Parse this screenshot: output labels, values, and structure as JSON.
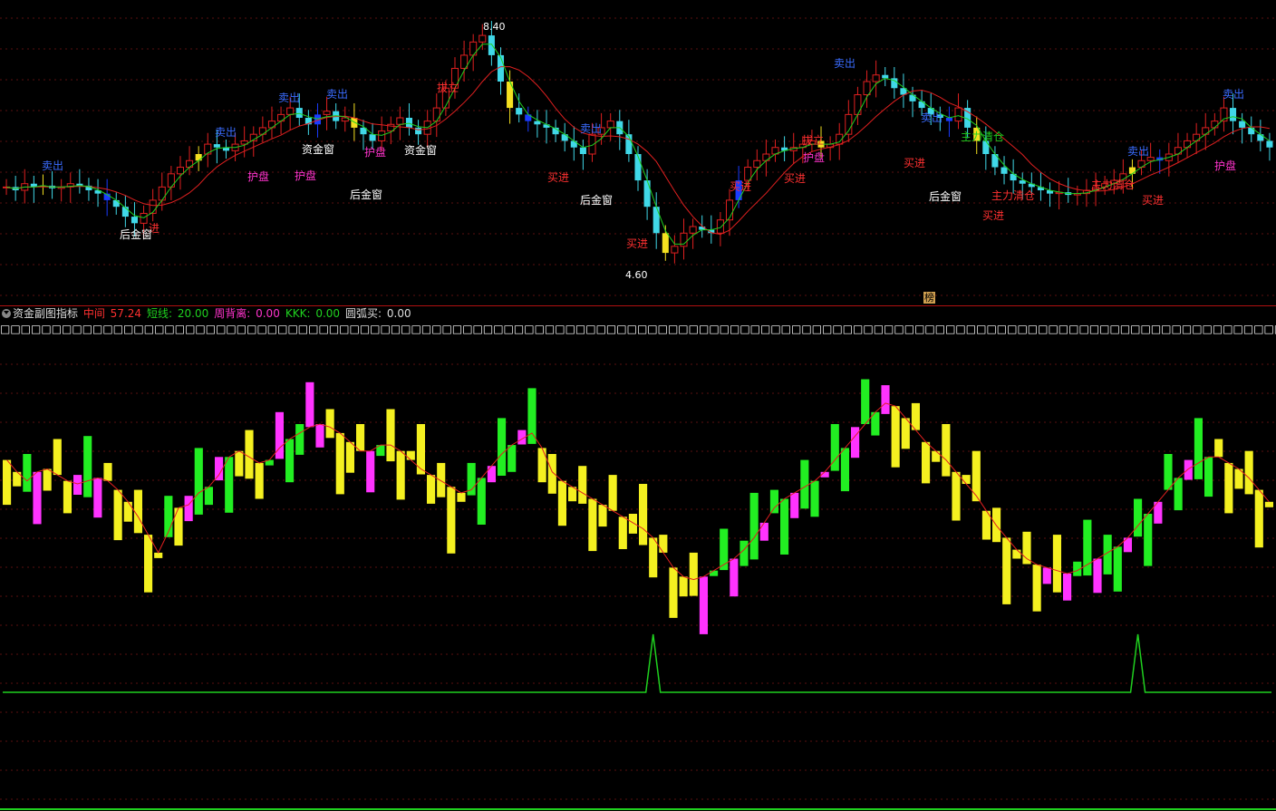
{
  "main_chart": {
    "high_label": "8.40",
    "low_label": "4.60",
    "annotations": [
      {
        "text": "卖出",
        "color": "#3a6cff",
        "x": 58,
        "y": 187
      },
      {
        "text": "进",
        "color": "#ff3030",
        "x": 170,
        "y": 256
      },
      {
        "text": "后金窗",
        "color": "#ffffff",
        "x": 150,
        "y": 263
      },
      {
        "text": "卖出",
        "color": "#3a6cff",
        "x": 249,
        "y": 150
      },
      {
        "text": "卖出",
        "color": "#3a6cff",
        "x": 319,
        "y": 112
      },
      {
        "text": "卖出",
        "color": "#3a6cff",
        "x": 372,
        "y": 108
      },
      {
        "text": "护盘",
        "color": "#ff33cc",
        "x": 285,
        "y": 199
      },
      {
        "text": "护盘",
        "color": "#ff33cc",
        "x": 337,
        "y": 198
      },
      {
        "text": "资金窗",
        "color": "#ffffff",
        "x": 351,
        "y": 169
      },
      {
        "text": "护盘",
        "color": "#ff33cc",
        "x": 414,
        "y": 172
      },
      {
        "text": "后金窗",
        "color": "#ffffff",
        "x": 404,
        "y": 219
      },
      {
        "text": "资金窗",
        "color": "#ffffff",
        "x": 464,
        "y": 170
      },
      {
        "text": "拔立",
        "color": "#ff3030",
        "x": 494,
        "y": 101
      },
      {
        "text": "卖出",
        "color": "#3a6cff",
        "x": 652,
        "y": 146
      },
      {
        "text": "买进",
        "color": "#ff3030",
        "x": 616,
        "y": 200
      },
      {
        "text": "后金窗",
        "color": "#ffffff",
        "x": 658,
        "y": 225
      },
      {
        "text": "买进",
        "color": "#ff3030",
        "x": 703,
        "y": 273
      },
      {
        "text": "买进",
        "color": "#ff3030",
        "x": 817,
        "y": 210
      },
      {
        "text": "买进",
        "color": "#ff3030",
        "x": 877,
        "y": 201
      },
      {
        "text": "拔立",
        "color": "#ff3030",
        "x": 897,
        "y": 159
      },
      {
        "text": "护盘",
        "color": "#ff33cc",
        "x": 898,
        "y": 178
      },
      {
        "text": "卖出",
        "color": "#3a6cff",
        "x": 932,
        "y": 74
      },
      {
        "text": "卖出",
        "color": "#3a6cff",
        "x": 1028,
        "y": 134
      },
      {
        "text": "买进",
        "color": "#ff3030",
        "x": 1009,
        "y": 184
      },
      {
        "text": "主力清仓",
        "color": "#1fd01f",
        "x": 1084,
        "y": 155
      },
      {
        "text": "后金窗",
        "color": "#ffffff",
        "x": 1043,
        "y": 221
      },
      {
        "text": "主力清仓",
        "color": "#ff3030",
        "x": 1118,
        "y": 220
      },
      {
        "text": "买进",
        "color": "#ff3030",
        "x": 1096,
        "y": 242
      },
      {
        "text": "卖出",
        "color": "#3a6cff",
        "x": 1256,
        "y": 171
      },
      {
        "text": "主力清仓",
        "color": "#ff3030",
        "x": 1228,
        "y": 208
      },
      {
        "text": "买进",
        "color": "#ff3030",
        "x": 1272,
        "y": 225
      },
      {
        "text": "卖出",
        "color": "#3a6cff",
        "x": 1361,
        "y": 108
      },
      {
        "text": "护盘",
        "color": "#ff33cc",
        "x": 1352,
        "y": 187
      }
    ],
    "corner_badge": "榜"
  },
  "info_bar": {
    "indicator_name": "资金副图指标",
    "items": [
      {
        "label": "中间",
        "value": "57.24",
        "label_color": "#ff3030",
        "value_color": "#ff3030"
      },
      {
        "label": "短线:",
        "value": "20.00",
        "label_color": "#1fd01f",
        "value_color": "#1fd01f"
      },
      {
        "label": "周背离:",
        "value": "0.00",
        "label_color": "#ff33cc",
        "value_color": "#ff33cc"
      },
      {
        "label": "KKK:",
        "value": "0.00",
        "label_color": "#1fd01f",
        "value_color": "#1fd01f"
      },
      {
        "label": "圆弧买:",
        "value": "0.00",
        "label_color": "#dddddd",
        "value_color": "#dddddd"
      }
    ]
  },
  "indicator_strip": "□□□□□□□□□□□□□□□□□□□□□□□□□□□□□□□□□□□□□□□□□□□□□□□□□□□□□□□□□□□□□□□□□□□□□□□□□□□□□□□□□□□□□□□□□□□□□□□□□□□□□□□□□□□□□□□□□□□□□□□□□□□□□□□□□□",
  "chart_data": [
    {
      "type": "candlestick",
      "title": "",
      "ylim": [
        4.2,
        8.6
      ],
      "high_marker": 8.4,
      "low_marker": 4.6,
      "close_series": [
        5.9,
        5.85,
        5.95,
        5.9,
        5.92,
        5.88,
        5.9,
        5.95,
        5.92,
        5.85,
        5.8,
        5.7,
        5.6,
        5.45,
        5.35,
        5.5,
        5.7,
        5.9,
        6.1,
        6.2,
        6.3,
        6.4,
        6.55,
        6.5,
        6.45,
        6.55,
        6.6,
        6.7,
        6.8,
        6.9,
        7.0,
        7.1,
        6.95,
        6.85,
        7.0,
        7.05,
        6.9,
        6.95,
        6.8,
        6.7,
        6.6,
        6.75,
        6.85,
        6.95,
        6.8,
        6.7,
        6.9,
        7.1,
        7.4,
        7.7,
        7.9,
        8.1,
        8.2,
        7.9,
        7.5,
        7.1,
        7.0,
        6.9,
        6.85,
        6.8,
        6.7,
        6.6,
        6.5,
        6.4,
        6.7,
        6.8,
        6.9,
        6.7,
        6.4,
        6.0,
        5.6,
        5.2,
        4.9,
        5.0,
        5.2,
        5.3,
        5.25,
        5.2,
        5.4,
        5.7,
        6.0,
        6.2,
        6.3,
        6.4,
        6.5,
        6.45,
        6.5,
        6.55,
        6.6,
        6.5,
        6.55,
        6.7,
        7.0,
        7.3,
        7.5,
        7.6,
        7.55,
        7.4,
        7.3,
        7.2,
        7.1,
        7.0,
        6.95,
        6.9,
        7.1,
        6.8,
        6.6,
        6.4,
        6.2,
        6.1,
        6.0,
        5.95,
        5.9,
        5.85,
        5.8,
        5.82,
        5.78,
        5.8,
        5.85,
        5.9,
        5.95,
        6.0,
        6.1,
        6.2,
        6.3,
        6.35,
        6.3,
        6.4,
        6.5,
        6.6,
        6.7,
        6.8,
        6.9,
        7.1,
        6.9,
        6.8,
        6.7,
        6.6,
        6.5
      ]
    },
    {
      "type": "bar",
      "title": "资金副图指标",
      "ylim": [
        0,
        100
      ],
      "values": [
        68,
        60,
        62,
        66,
        64,
        62,
        60,
        60,
        62,
        62,
        60,
        56,
        52,
        46,
        40,
        34,
        54,
        50,
        56,
        58,
        60,
        66,
        72,
        70,
        68,
        66,
        70,
        74,
        76,
        78,
        80,
        80,
        78,
        76,
        72,
        70,
        72,
        74,
        72,
        70,
        66,
        64,
        62,
        60,
        58,
        56,
        60,
        64,
        68,
        72,
        74,
        76,
        78,
        66,
        62,
        60,
        58,
        56,
        54,
        52,
        50,
        48,
        46,
        44,
        40,
        34,
        30,
        28,
        28,
        30,
        32,
        34,
        36,
        40,
        44,
        50,
        54,
        56,
        58,
        60,
        62,
        66,
        70,
        74,
        78,
        82,
        86,
        88,
        84,
        80,
        76,
        72,
        70,
        66,
        62,
        58,
        54,
        48,
        44,
        40,
        36,
        34,
        32,
        32,
        30,
        30,
        32,
        34,
        36,
        38,
        40,
        44,
        48,
        52,
        56,
        60,
        64,
        66,
        68,
        70,
        68,
        66,
        64,
        60,
        56,
        52
      ],
      "kkk_line": {
        "baseline": 0,
        "spikes": [
          {
            "index": 64,
            "value": 20.0
          },
          {
            "index": 112,
            "value": 20.0
          }
        ]
      }
    }
  ]
}
